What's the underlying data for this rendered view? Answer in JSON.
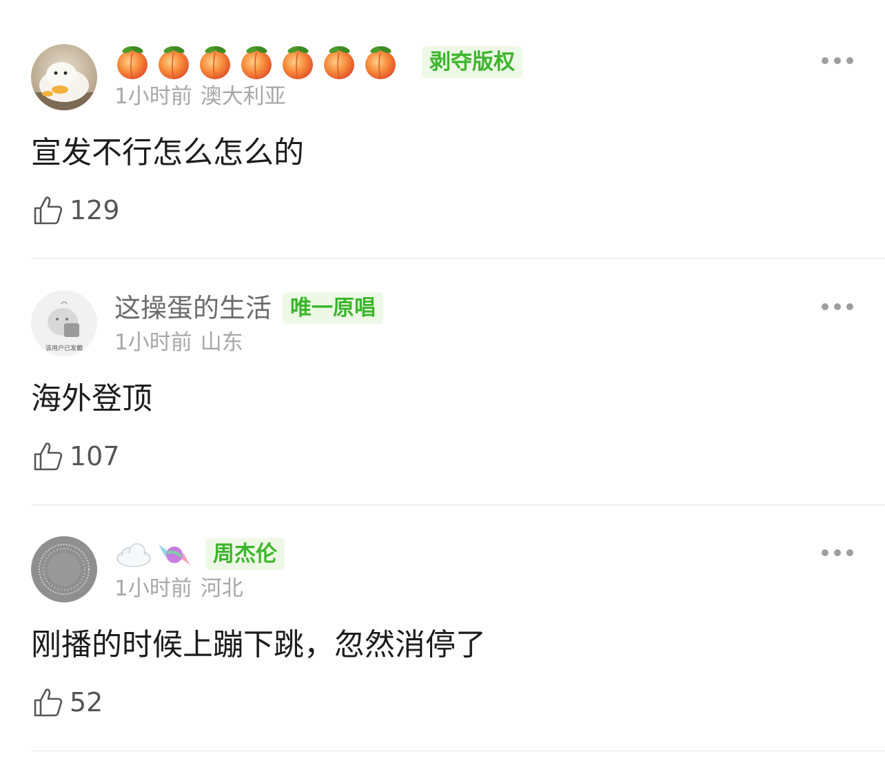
{
  "comments": [
    {
      "username_icons": [
        "peach-icon",
        "peach-icon",
        "peach-icon",
        "peach-icon",
        "peach-icon",
        "peach-icon",
        "peach-icon"
      ],
      "badge": "剥夺版权",
      "time": "1小时前",
      "location": "澳大利亚",
      "text": "宣发不行怎么怎么的",
      "likes": "129"
    },
    {
      "username": "这操蛋的生活",
      "badge": "唯一原唱",
      "avatar_text": "该用户已发癫",
      "time": "1小时前",
      "location": "山东",
      "text": "海外登顶",
      "likes": "107"
    },
    {
      "username_icons": [
        "cloud-icon",
        "candy-icon"
      ],
      "badge": "周杰伦",
      "time": "1小时前",
      "location": "河北",
      "text": "刚播的时候上蹦下跳，忽然消停了",
      "likes": "52"
    }
  ],
  "colors": {
    "badge_text": "#3cb52c",
    "badge_bg": "#eef8e6",
    "meta_text": "#a7a7a7",
    "username_text": "#6b6b6b"
  }
}
